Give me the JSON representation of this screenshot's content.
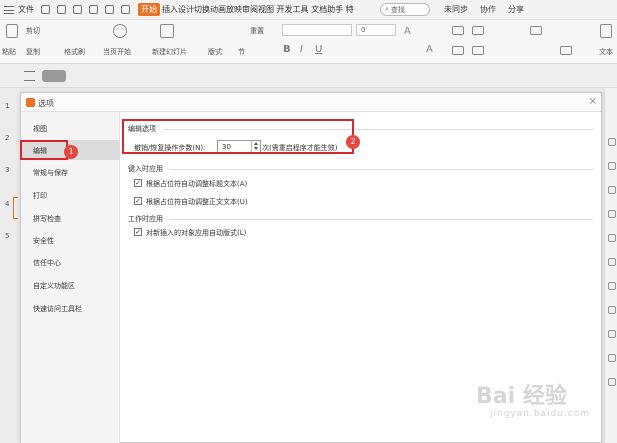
{
  "topbar": {
    "file": "文件",
    "start_tab": "开始",
    "tabs": "插入设计切换动画放映审阅视图 开发工具 文档助手 特",
    "search_placeholder": "查找",
    "not_synced": "未同步",
    "collaborate": "协作",
    "share": "分享"
  },
  "ribbon": {
    "paste": "粘贴",
    "cut": "剪切",
    "copy": "复制",
    "format_painter": "格式刷",
    "from_start": "当页开始",
    "new_slide": "新建幻灯片",
    "layout": "版式",
    "section": "节",
    "reset": "重置",
    "font_size": "0",
    "text_tool": "文本"
  },
  "slides": [
    "1",
    "2",
    "3",
    "4",
    "5"
  ],
  "dialog": {
    "title": "选项",
    "close": "×",
    "nav": [
      {
        "label": "视图"
      },
      {
        "label": "编辑"
      },
      {
        "label": "常规与保存"
      },
      {
        "label": "打印"
      },
      {
        "label": "拼写检查"
      },
      {
        "label": "安全性"
      },
      {
        "label": "信任中心"
      },
      {
        "label": "自定义功能区"
      },
      {
        "label": "快速访问工具栏"
      }
    ],
    "active_nav": "编辑",
    "edit_options": {
      "heading": "编辑选项",
      "undo_label": "撤销/恢复操作步数(N):",
      "undo_value": "30",
      "undo_suffix": "次(需重启程序才能生效)"
    },
    "input_apply": {
      "heading": "键入时应用",
      "opt1": "根据占位符自动调整标题文本(A)",
      "opt2": "根据占位符自动调整正文文本(U)"
    },
    "work_apply": {
      "heading": "工作时应用",
      "opt1": "对新插入的对象应用自动版式(L)"
    },
    "check_mark": "✓"
  },
  "annotations": {
    "badge1": "1",
    "badge2": "2",
    "color": "#d9262b"
  },
  "watermark": {
    "main": "Bai 经验",
    "sub": "jingyan.baidu.com"
  },
  "colors": {
    "accent": "#e77326",
    "annotation": "#d9262b"
  }
}
